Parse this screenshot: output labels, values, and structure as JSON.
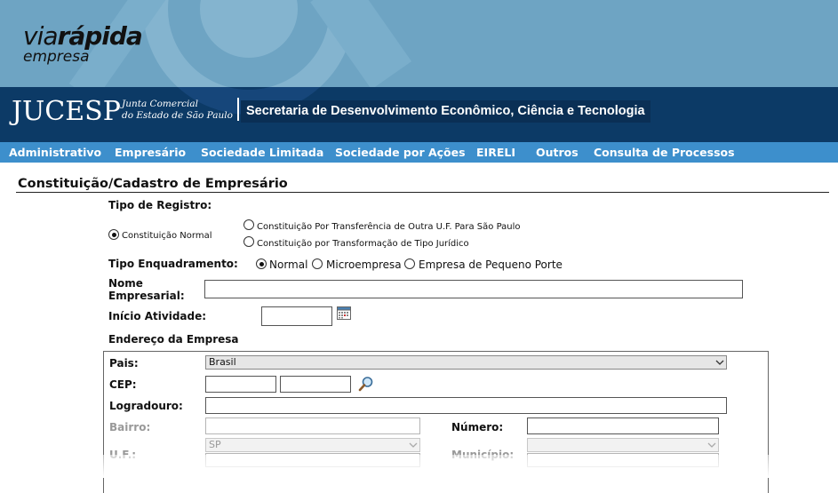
{
  "brand": {
    "via": "via",
    "rapida": "rápida",
    "empresa": "empresa"
  },
  "gov": {
    "logo": "JUCESP",
    "junta_line1": "Junta Comercial",
    "junta_line2": "do Estado de São Paulo",
    "secretaria": "Secretaria de Desenvolvimento Econômico, Ciência e Tecnologia"
  },
  "menu": [
    "Administrativo",
    "Empresário",
    "Sociedade Limitada",
    "Sociedade por Ações",
    "EIRELI",
    "Outros",
    "Consulta de Processos"
  ],
  "form": {
    "title": "Constituição/Cadastro de Empresário",
    "tipo_registro": {
      "label": "Tipo de Registro:",
      "options": [
        {
          "label": "Constituição Normal",
          "checked": true
        },
        {
          "label": "Constituição Por Transferência de Outra U.F. Para São Paulo",
          "checked": false
        },
        {
          "label": "Constituição por Transformação de Tipo Jurídico",
          "checked": false
        }
      ]
    },
    "tipo_enquadramento": {
      "label": "Tipo Enquadramento:",
      "options": [
        {
          "label": "Normal",
          "checked": true
        },
        {
          "label": "Microempresa",
          "checked": false
        },
        {
          "label": "Empresa de Pequeno Porte",
          "checked": false
        }
      ]
    },
    "nome_label_1": "Nome",
    "nome_label_2": "Empresarial:",
    "nome_value": "",
    "inicio_label": "Início Atividade:",
    "inicio_value": "",
    "endereco_label": "Endereço da Empresa",
    "pais_label": "Pais:",
    "pais_value": "Brasil",
    "cep_label": "CEP:",
    "logradouro_label": "Logradouro:",
    "bairro_label": "Bairro:",
    "numero_label": "Número:",
    "uf_label": "U.F.:",
    "uf_value": "SP",
    "municipio_label": "Município:",
    "municipio_value": ""
  },
  "icons": {
    "calendar": "calendar-icon",
    "search": "magnifier-icon"
  }
}
